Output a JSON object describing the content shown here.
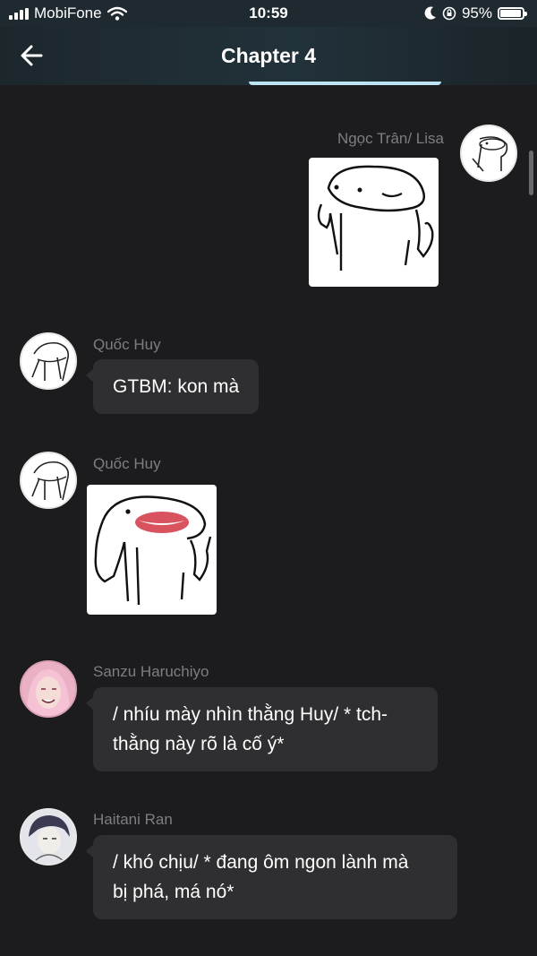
{
  "status_bar": {
    "carrier": "MobiFone",
    "time": "10:59",
    "battery": "95%",
    "battery_level": 0.95
  },
  "header": {
    "title": "Chapter 4",
    "back_icon": "arrow-left-icon"
  },
  "messages": [
    {
      "sender": "Ngọc Trân/ Lisa",
      "type": "sticker",
      "sticker": "blob-thumbs-up"
    },
    {
      "sender": "Quốc Huy",
      "type": "text",
      "text": "GTBM: kon mà"
    },
    {
      "sender": "Quốc Huy",
      "type": "sticker",
      "sticker": "blob-smile-lips-thumbs-up"
    },
    {
      "sender": "Sanzu Haruchiyo",
      "type": "text",
      "lines": [
        "/ nhíu mày nhìn thằng Huy/ * tch-",
        "thằng này rõ là cố ý*"
      ]
    },
    {
      "sender": "Haitani Ran",
      "type": "text",
      "lines": [
        "/ khó chịu/ * đang ôm ngon lành mà",
        "bị phá, má nó*"
      ]
    }
  ],
  "colors": {
    "background": "#1c1c1e",
    "bubble": "#2f2f31",
    "sender": "#7e7e82",
    "header_accent": "#bde4f2"
  }
}
